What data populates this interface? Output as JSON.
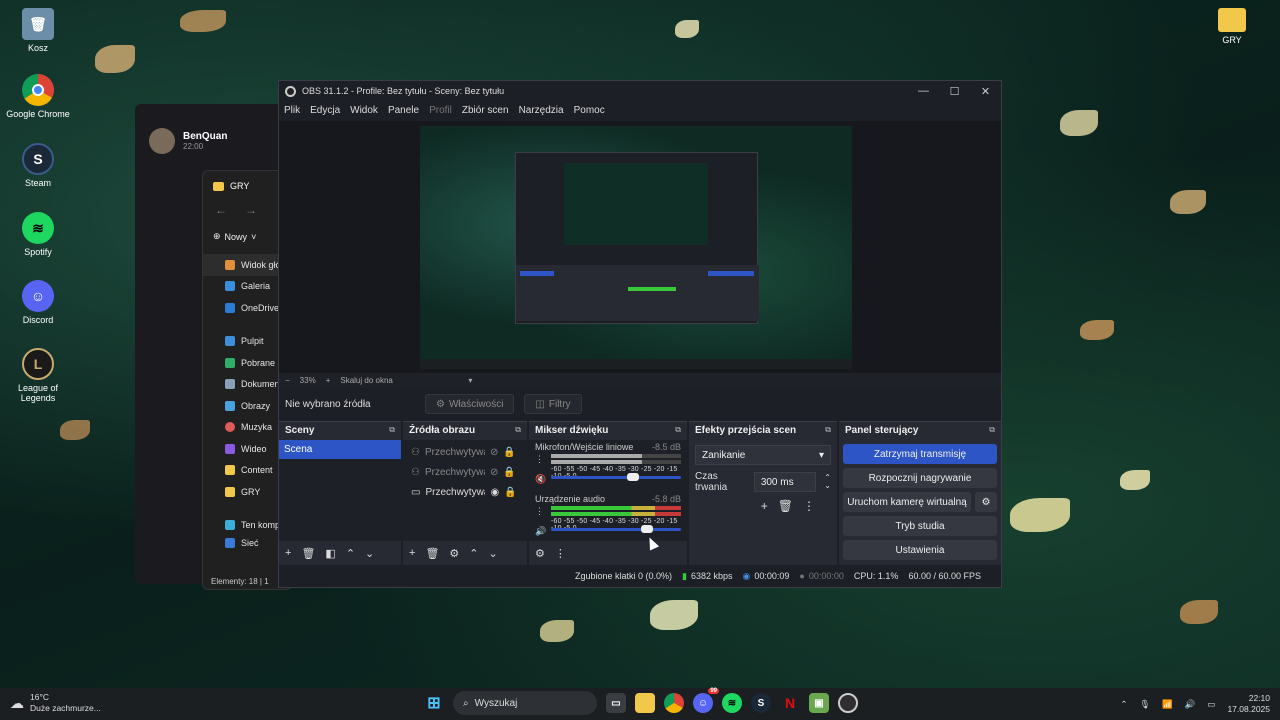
{
  "desktop": {
    "icons": [
      {
        "label": "Kosz",
        "icon": "recycle-bin-icon"
      },
      {
        "label": "Google Chrome",
        "icon": "chrome-icon"
      },
      {
        "label": "Steam",
        "icon": "steam-icon"
      },
      {
        "label": "Spotify",
        "icon": "spotify-icon"
      },
      {
        "label": "Discord",
        "icon": "discord-icon"
      },
      {
        "label": "League of Legends",
        "icon": "league-icon"
      }
    ],
    "right_icon": {
      "label": "GRY",
      "icon": "folder-icon"
    }
  },
  "discord": {
    "username": "BenQuan",
    "time": "22:00"
  },
  "explorer": {
    "title": "GRY",
    "new_label": "Nowy",
    "nav": [
      "Widok głó",
      "Galeria",
      "OneDrive",
      "Pulpit",
      "Pobrane",
      "Dokumenty",
      "Obrazy",
      "Muzyka",
      "Wideo",
      "Content",
      "GRY",
      "Ten kompu",
      "Sieć"
    ],
    "status": "Elementy: 18 | 1"
  },
  "obs": {
    "title": "OBS 31.1.2 - Profile: Bez tytułu - Sceny: Bez tytułu",
    "menu": [
      "Plik",
      "Edycja",
      "Widok",
      "Panele",
      "Profil",
      "Zbiór scen",
      "Narzędzia",
      "Pomoc"
    ],
    "zoom": "33%",
    "scale_mode": "Skaluj do okna",
    "no_source": "Nie wybrano źródła",
    "properties_btn": "Właściwości",
    "filters_btn": "Filtry",
    "scenes": {
      "title": "Sceny",
      "items": [
        "Scena"
      ]
    },
    "sources": {
      "title": "Źródła obrazu",
      "items": [
        "Przechwytywar",
        "Przechwytywar",
        "Przechwytywar"
      ]
    },
    "mixer": {
      "title": "Mikser dźwięku",
      "scale": "-60 -55 -50 -45 -40 -35 -30 -25 -20 -15 -10 -5 0",
      "channels": [
        {
          "name": "Mikrofon/Wejście liniowe",
          "db": "-8.5 dB",
          "level": 0.7,
          "muted": true
        },
        {
          "name": "Urządzenie audio",
          "db": "-5.8 dB",
          "level": 0.78,
          "muted": false
        }
      ]
    },
    "transitions": {
      "title": "Efekty przejścia scen",
      "type": "Zanikanie",
      "duration_label": "Czas trwania",
      "duration": "300 ms"
    },
    "controls": {
      "title": "Panel sterujący",
      "stop_stream": "Zatrzymaj transmisję",
      "start_record": "Rozpocznij nagrywanie",
      "virtual_cam": "Uruchom kamerę wirtualną",
      "studio_mode": "Tryb studia",
      "settings": "Ustawienia"
    },
    "status": {
      "dropped": "Zgubione klatki 0 (0.0%)",
      "bitrate": "6382 kbps",
      "stream_time": "00:00:09",
      "rec_time": "00:00:00",
      "cpu": "CPU: 1.1%",
      "fps": "60.00 / 60.00 FPS"
    }
  },
  "taskbar": {
    "weather_temp": "16°C",
    "weather_desc": "Duże zachmurze...",
    "search": "Wyszukaj",
    "discord_badge": "99",
    "time": "22:10",
    "date": "17.08.2025"
  }
}
